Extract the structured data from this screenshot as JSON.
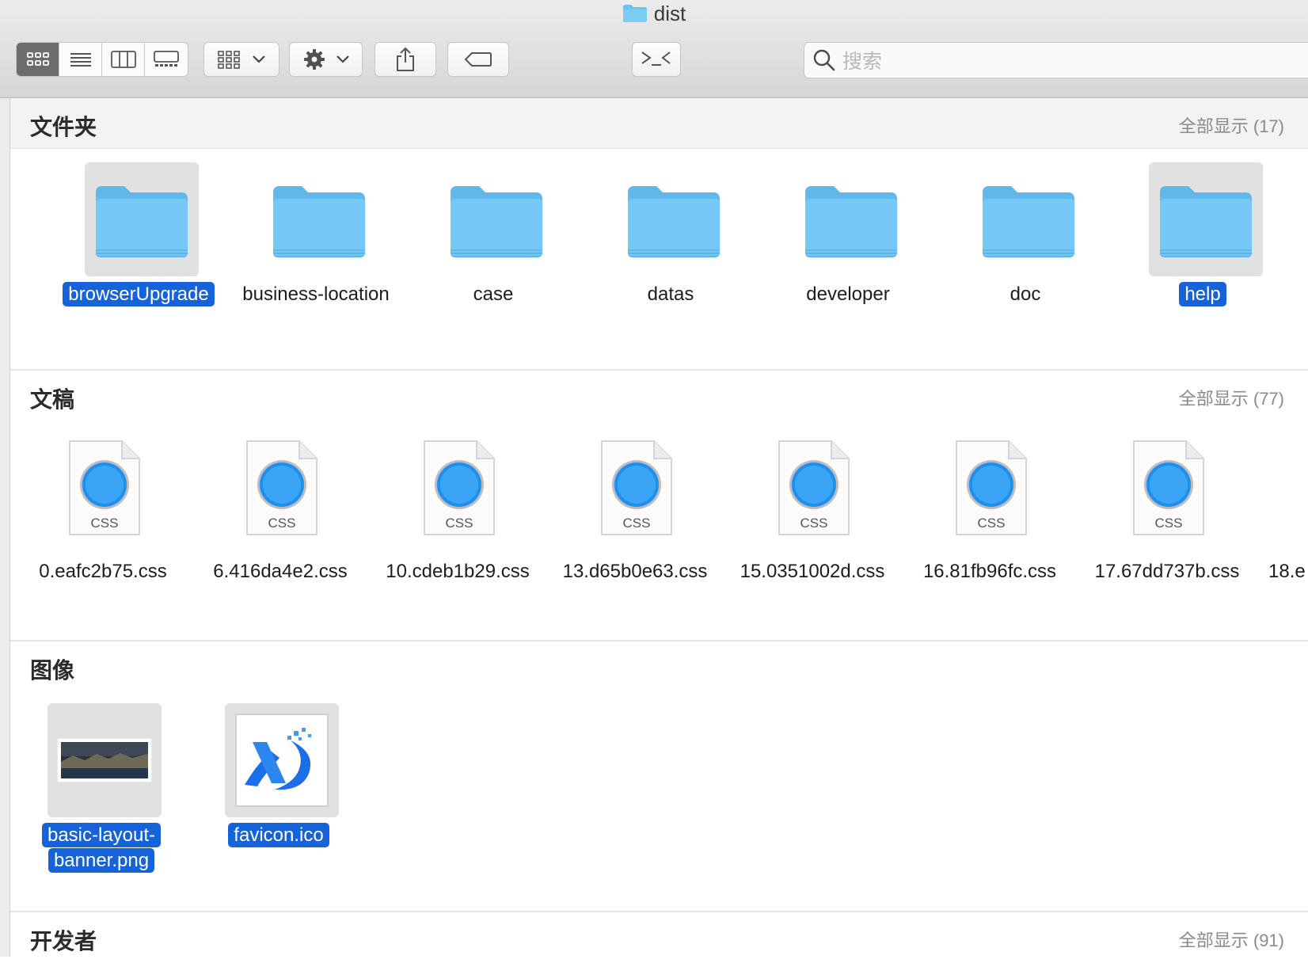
{
  "window": {
    "title": "dist"
  },
  "toolbar": {
    "view_modes": [
      "icon-view",
      "list-view",
      "column-view",
      "gallery-view"
    ],
    "search_placeholder": "搜索"
  },
  "sections": {
    "folders": {
      "title": "文件夹",
      "show_all": "全部显示 (17)",
      "items": [
        {
          "name": "browserUpgrade",
          "selected": true
        },
        {
          "name": "business-location",
          "selected": false
        },
        {
          "name": "case",
          "selected": false
        },
        {
          "name": "datas",
          "selected": false
        },
        {
          "name": "developer",
          "selected": false
        },
        {
          "name": "doc",
          "selected": false
        },
        {
          "name": "help",
          "selected": true
        }
      ]
    },
    "documents": {
      "title": "文稿",
      "show_all": "全部显示 (77)",
      "icon_label": "CSS",
      "items": [
        {
          "name": "0.eafc2b75.css"
        },
        {
          "name": "6.416da4e2.css"
        },
        {
          "name": "10.cdeb1b29.css"
        },
        {
          "name": "13.d65b0e63.css"
        },
        {
          "name": "15.0351002d.css"
        },
        {
          "name": "16.81fb96fc.css"
        },
        {
          "name": "17.67dd737b.css"
        },
        {
          "name": "18.e"
        }
      ]
    },
    "images": {
      "title": "图像",
      "items": [
        {
          "name": "basic-layout-banner.png",
          "line1": "basic-layout-",
          "line2": "banner.png",
          "selected": true
        },
        {
          "name": "favicon.ico",
          "selected": true
        }
      ]
    },
    "developer": {
      "title": "开发者",
      "show_all": "全部显示 (91)"
    }
  },
  "colors": {
    "selection": "#1662d8",
    "folder": "#6fc3f0",
    "safari_blue": "#1f8ef0",
    "favicon_blue": "#1a6fe8"
  }
}
